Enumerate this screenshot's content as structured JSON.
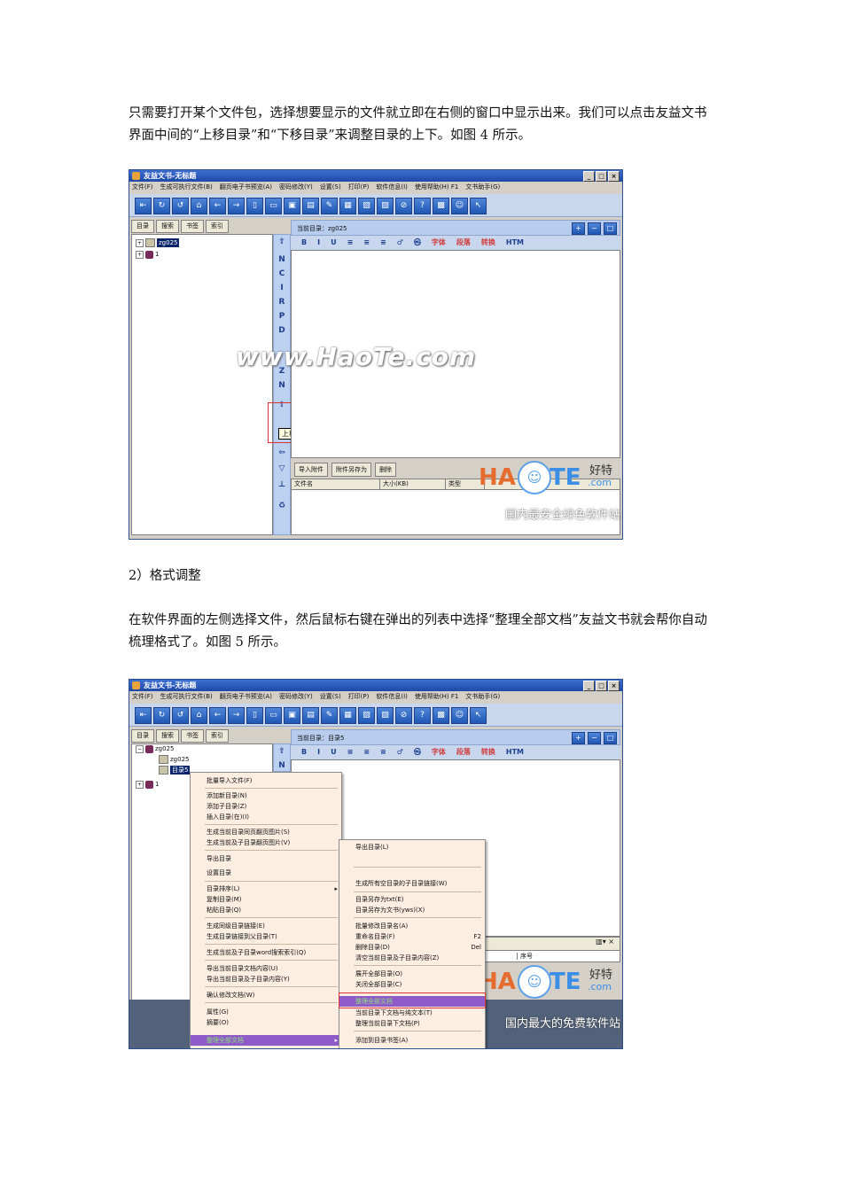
{
  "paragraphs": {
    "p1": "只需要打开某个文件包，选择想要显示的文件就立即在右侧的窗口中显示出来。我们可以点击友益文书界面中间的“上移目录”和“下移目录”来调整目录的上下。如图 4 所示。",
    "h2": "2）格式调整",
    "p2": "在软件界面的左侧选择文件，然后鼠标右键在弹出的列表中选择“整理全部文档”友益文书就会帮你自动梳理格式了。如图 5 所示。"
  },
  "app": {
    "title": "友益文书-无标题",
    "menus": [
      "文件(F)",
      "生成可执行文件(B)",
      "翻页电子书预览(A)",
      "密码修改(Y)",
      "设置(S)",
      "打印(P)",
      "软件信息(I)",
      "使用帮助(H) F1",
      "文书助手(G)"
    ],
    "toolbar_icons": [
      "⇤",
      "↻",
      "↺",
      "⌂",
      "←",
      "→",
      "▯",
      "▭",
      "▣",
      "▤",
      "✎",
      "▦",
      "▧",
      "▨",
      "⊘",
      "?",
      "▩",
      "☺",
      "↖"
    ],
    "left_tabs": [
      "目录",
      "搜索",
      "书签",
      "索引"
    ],
    "format_buttons": [
      "B",
      "I",
      "U",
      "≡",
      "≡",
      "≡",
      "♂",
      "㉿"
    ],
    "format_red": [
      "字体",
      "段落",
      "转换"
    ],
    "format_last": "HTM",
    "attach_buttons": [
      "导入附件",
      "附件另存为",
      "删除"
    ],
    "attach_columns": [
      "文件名",
      "大小(KB)",
      "类型"
    ],
    "side_letters": [
      "N",
      "C",
      "I",
      "R",
      "P",
      "D",
      "Z",
      "N"
    ],
    "watermark": "www.HaoTe.com",
    "logo_ha": "HA",
    "logo_te": "TE",
    "logo_cn": "好特",
    "logo_com": ".com",
    "slogan_fig4": "国内最安全绿色软件站",
    "slogan_fig5": "国内最大的免费软件站"
  },
  "fig4": {
    "current_dir": "当前目录：zg025",
    "tree": [
      {
        "label": "zg025",
        "selected": true
      },
      {
        "label": "1",
        "selected": false
      }
    ],
    "tooltip": "上移目录"
  },
  "fig5": {
    "current_dir": "当前目录：目录5",
    "tree": [
      {
        "label": "zg025"
      },
      {
        "label": "zg025"
      },
      {
        "label": "目录5",
        "selected": true
      },
      {
        "label": "1"
      }
    ],
    "right_panel_cols": [
      "序号"
    ],
    "menu1": [
      {
        "label": "批量导入文件(F)"
      },
      {
        "label": "添加新目录(N)"
      },
      {
        "label": "添加子目录(Z)"
      },
      {
        "label": "插入目录(在)(I)"
      },
      {
        "label": "生成当前目录同页翻页图片(S)"
      },
      {
        "label": "生成当前及子目录翻页图片(V)"
      },
      {
        "label": "导出目录"
      },
      {
        "label": "设置目录"
      },
      {
        "label": "目录排序(L)"
      },
      {
        "label": "复制目录(M)"
      },
      {
        "label": "粘贴目录(Q)"
      },
      {
        "label": "生成同级目录链接(E)"
      },
      {
        "label": "生成目录链接到父目录(T)"
      },
      {
        "label": "生成当前及子目录word搜索索引(Q)"
      },
      {
        "label": "导出当前目录文档内容(U)"
      },
      {
        "label": "导出当前目录及子目录内容(Y)"
      },
      {
        "label": "确认修改文档(W)"
      },
      {
        "label": "属性(G)"
      },
      {
        "label": "摘要(O)"
      },
      {
        "label": "整理全部文档"
      }
    ],
    "menu2": [
      {
        "label": "导出目录(L)",
        "hot": ""
      },
      {
        "label": "生成所有空目录的子目录链接(W)",
        "hot": ""
      },
      {
        "label": "目录另存为txt(E)",
        "hot": ""
      },
      {
        "label": "目录另存为文书(yws)(X)",
        "hot": ""
      },
      {
        "label": "批量修改目录名(A)",
        "hot": ""
      },
      {
        "label": "重命名目录(F)",
        "hot": "F2"
      },
      {
        "label": "删除目录(D)",
        "hot": "Del"
      },
      {
        "label": "清空当前目录及子目录内容(Z)",
        "hot": ""
      },
      {
        "label": "展开全部目录(O)",
        "hot": ""
      },
      {
        "label": "关闭全部目录(C)",
        "hot": ""
      },
      {
        "label": "整理全部文档",
        "hot": ""
      },
      {
        "label": "当前目录下文档与纯文本(T)",
        "hot": ""
      },
      {
        "label": "整理当前目录下文档(P)",
        "hot": ""
      },
      {
        "label": "添加到目录书签(A)",
        "hot": ""
      }
    ]
  }
}
